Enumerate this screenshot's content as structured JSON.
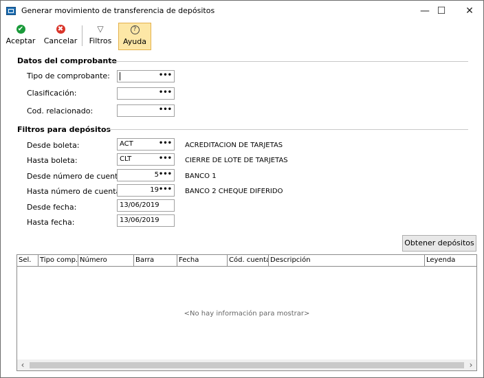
{
  "window": {
    "title": "Generar movimiento de transferencia de depósitos",
    "minimize": "—",
    "maximize": "☐",
    "close": "✕"
  },
  "toolbar": {
    "accept_label": "Aceptar",
    "cancel_label": "Cancelar",
    "filters_label": "Filtros",
    "help_label": "Ayuda",
    "accept_icon": "✔",
    "cancel_icon": "✖",
    "filters_icon": "▽",
    "help_icon": "?"
  },
  "voucher_section": {
    "title": "Datos del comprobante",
    "fields": [
      {
        "label": "Tipo de comprobante:",
        "value": ""
      },
      {
        "label": "Clasificación:",
        "value": ""
      },
      {
        "label": "Cod. relacionado:",
        "value": ""
      }
    ]
  },
  "filters_section": {
    "title": "Filtros para depósitos",
    "desde_boleta": {
      "label": "Desde boleta:",
      "value": "ACT",
      "description": "ACREDITACION DE TARJETAS"
    },
    "hasta_boleta": {
      "label": "Hasta boleta:",
      "value": "CLT",
      "description": "CIERRE DE LOTE DE TARJETAS"
    },
    "desde_cuenta": {
      "label": "Desde número de cuenta:",
      "value": "5",
      "description": "BANCO 1"
    },
    "hasta_cuenta": {
      "label": "Hasta número de cuenta:",
      "value": "19",
      "description": "BANCO 2 CHEQUE DIFERIDO"
    },
    "desde_fecha": {
      "label": "Desde fecha:",
      "value": "13/06/2019"
    },
    "hasta_fecha": {
      "label": "Hasta fecha:",
      "value": "13/06/2019"
    },
    "lookup_glyph": "•••"
  },
  "obtain_button": "Obtener depósitos",
  "grid": {
    "columns": [
      "Sel.",
      "Tipo comp.",
      "Número",
      "Barra",
      "Fecha",
      "Cód. cuenta",
      "Descripción",
      "Leyenda"
    ],
    "empty_message": "<No hay información para mostrar>",
    "scroll_left": "‹",
    "scroll_right": "›"
  }
}
